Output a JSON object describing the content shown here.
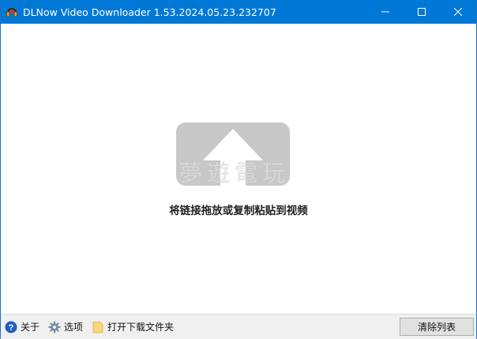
{
  "window": {
    "title": "DLNow Video Downloader 1.53.2024.05.23.232707",
    "accent_color": "#0078d7",
    "app_icon": "headphones-app-icon",
    "minimize_icon": "minimize-icon",
    "maximize_icon": "maximize-icon",
    "close_icon": "close-icon"
  },
  "drop_area": {
    "graphic_icon": "upload-arrow-icon",
    "watermark": "夢遊電玩",
    "hint": "将链接拖放或复制粘贴到视频"
  },
  "toolbar": {
    "about": {
      "icon": "help-icon",
      "label": "关于"
    },
    "options": {
      "icon": "gear-icon",
      "label": "选项"
    },
    "open_folder": {
      "icon": "folder-icon",
      "label": "打开下载文件夹"
    },
    "clear_list": "清除列表"
  }
}
